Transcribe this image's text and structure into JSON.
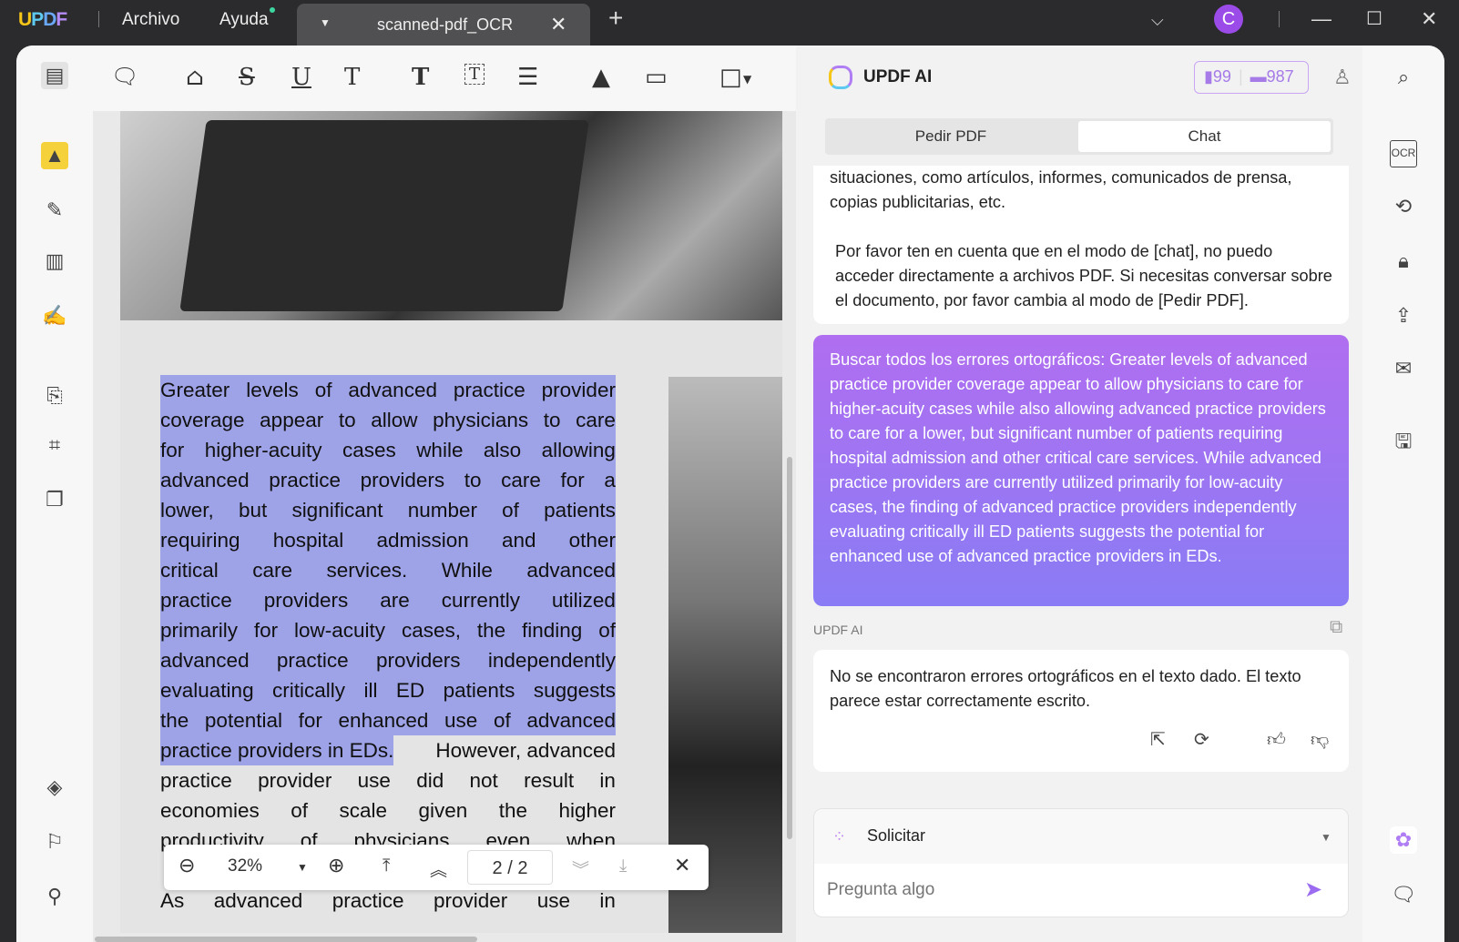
{
  "titlebar": {
    "logo": "UPDF",
    "menu": [
      "Archivo",
      "Ayuda"
    ],
    "tab_name": "scanned-pdf_OCR",
    "avatar_initial": "C"
  },
  "pdf": {
    "highlighted_lines": [
      [
        "Greater",
        "levels",
        "of",
        "advanced",
        "practice",
        "provider"
      ],
      [
        "coverage",
        "appear",
        "to",
        "allow",
        "physicians",
        "to",
        "care"
      ],
      [
        "for",
        "higher-acuity",
        "cases",
        "while",
        "also",
        "allowing"
      ],
      [
        "advanced",
        "practice",
        "providers",
        "to",
        "care",
        "for",
        "a"
      ],
      [
        "lower,",
        "but",
        "significant",
        "number",
        "of",
        "patients"
      ],
      [
        "requiring",
        "hospital",
        "admission",
        "and",
        "other"
      ],
      [
        "critical",
        "care",
        "services.",
        "While",
        "advanced"
      ],
      [
        "practice",
        "providers",
        "are",
        "currently",
        "utilized"
      ],
      [
        "primarily",
        "for",
        "low-acuity",
        "cases,",
        "the",
        "finding",
        "of"
      ],
      [
        "advanced",
        "practice",
        "providers",
        "independently"
      ],
      [
        "evaluating",
        "critically",
        "ill",
        "ED",
        "patients",
        "suggests"
      ],
      [
        "the",
        "potential",
        "for",
        "enhanced",
        "use",
        "of",
        "advanced"
      ]
    ],
    "mixed_line": {
      "highlighted": "practice providers in EDs.",
      "rest": "However, advanced"
    },
    "plain_lines": [
      [
        "practice",
        "provider",
        "use",
        "did",
        "not",
        "result",
        "in"
      ],
      [
        "economies",
        "of",
        "scale",
        "given",
        "the",
        "higher"
      ],
      [
        "productivity",
        "of",
        "physicians",
        "even",
        "when"
      ]
    ],
    "bottom_line": [
      "As",
      "advanced",
      "practice",
      "provider",
      "use",
      "in"
    ],
    "zoom": "32%",
    "page_current": "2",
    "page_sep": "/",
    "page_total": "2"
  },
  "ai": {
    "title": "UPDF AI",
    "doc_count": "99",
    "chat_count": "987",
    "tabs": [
      "Pedir PDF",
      "Chat"
    ],
    "active_tab": "Chat",
    "msg1_p1": "situaciones, como artículos, informes, comunicados de prensa, copias publicitarias, etc.",
    "msg1_p2": "Por favor ten en cuenta que en el modo de [chat], no puedo acceder directamente a archivos PDF. Si necesitas conversar sobre el documento, por favor cambia al modo de [Pedir PDF].",
    "user_msg": "Buscar todos los errores ortográficos: Greater levels of advanced practice provider coverage appear to allow physicians to care for higher-acuity cases while also allowing advanced practice providers to care for a lower, but significant number of patients requiring hospital admission and other critical care services. While advanced practice providers are currently utilized primarily for low-acuity cases, the finding of advanced practice providers independently evaluating critically ill ED patients suggests the potential for enhanced use of advanced practice providers in EDs.",
    "sender": "UPDF AI",
    "reply": "No se encontraron errores ortográficos en el texto dado. El texto parece estar correctamente escrito.",
    "prompt_mode": "Solicitar",
    "input_placeholder": "Pregunta algo",
    "accent": "#a67be8"
  }
}
